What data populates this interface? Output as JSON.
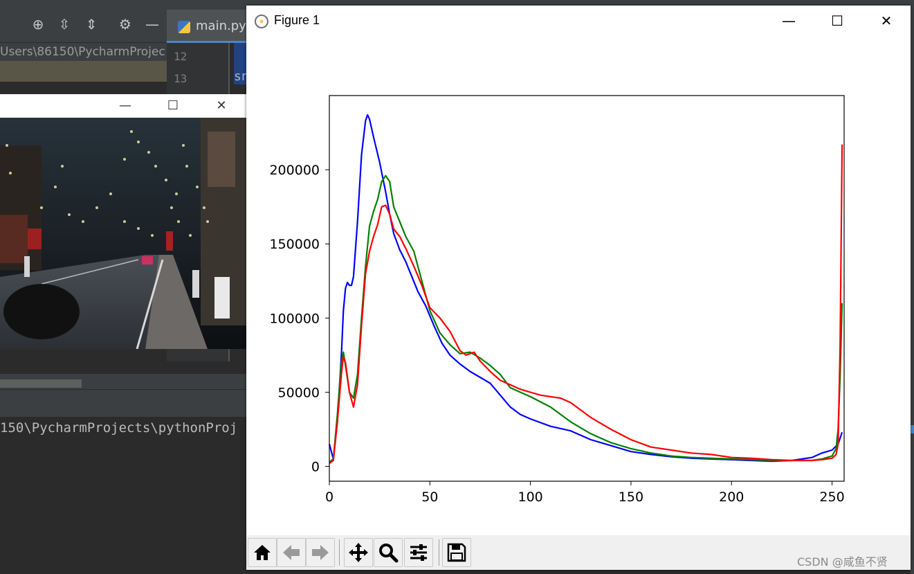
{
  "ide": {
    "tab_label": "main.py",
    "path_text": "Users\\86150\\PycharmProjec",
    "line_numbers": [
      "12",
      "13"
    ],
    "code_fragment": "sn",
    "console_text": "150\\PycharmProjects\\pythonProj",
    "top_right_label": "main"
  },
  "image_window": {
    "minimize_glyph": "—",
    "maximize_glyph": "☐",
    "close_glyph": "✕",
    "image_description": "night street with lit trees"
  },
  "figure": {
    "title": "Figure 1",
    "minimize_glyph": "—",
    "maximize_glyph": "☐",
    "close_glyph": "✕"
  },
  "toolbar_buttons": [
    "home",
    "back",
    "forward",
    "pan",
    "zoom",
    "configure-subplots",
    "save"
  ],
  "watermark": "CSDN @咸鱼不贤",
  "chart_data": {
    "type": "line",
    "title": "",
    "xlabel": "",
    "ylabel": "",
    "xlim": [
      0,
      256
    ],
    "ylim": [
      -10000,
      250000
    ],
    "xticks": [
      0,
      50,
      100,
      150,
      200,
      250
    ],
    "yticks": [
      0,
      50000,
      100000,
      150000,
      200000
    ],
    "legend": "none",
    "series": [
      {
        "color": "#0000ff",
        "x": [
          0,
          2,
          4,
          6,
          7,
          8,
          9,
          10,
          11,
          12,
          14,
          16,
          18,
          19,
          20,
          22,
          25,
          28,
          30,
          32,
          35,
          38,
          41,
          44,
          48,
          52,
          56,
          60,
          65,
          70,
          75,
          80,
          85,
          90,
          95,
          100,
          110,
          120,
          130,
          140,
          150,
          160,
          170,
          180,
          190,
          200,
          210,
          220,
          230,
          240,
          245,
          250,
          253,
          255
        ],
        "values": [
          15000,
          5000,
          30000,
          75000,
          105000,
          120000,
          124000,
          122000,
          122000,
          128000,
          165000,
          210000,
          233000,
          237000,
          234000,
          222000,
          205000,
          185000,
          170000,
          157000,
          146000,
          138000,
          128000,
          118000,
          108000,
          95000,
          83000,
          75000,
          69000,
          64000,
          60000,
          56000,
          48000,
          40000,
          35000,
          32000,
          27000,
          24000,
          18000,
          14000,
          10000,
          8000,
          6500,
          5500,
          5000,
          4500,
          4000,
          3500,
          4000,
          6000,
          9000,
          11000,
          15000,
          23000
        ]
      },
      {
        "color": "#008000",
        "x": [
          0,
          2,
          4,
          6,
          7,
          8,
          10,
          12,
          14,
          16,
          18,
          20,
          22,
          24,
          26,
          28,
          30,
          32,
          35,
          38,
          42,
          46,
          50,
          55,
          60,
          65,
          70,
          75,
          80,
          85,
          90,
          95,
          100,
          110,
          120,
          130,
          140,
          150,
          160,
          170,
          180,
          190,
          200,
          210,
          220,
          230,
          240,
          245,
          250,
          252,
          253,
          254,
          255
        ],
        "values": [
          3000,
          5000,
          35000,
          70000,
          77000,
          68000,
          50000,
          46000,
          62000,
          100000,
          135000,
          162000,
          172000,
          180000,
          192000,
          196000,
          192000,
          175000,
          165000,
          155000,
          145000,
          125000,
          105000,
          90000,
          82000,
          76000,
          77000,
          73000,
          68000,
          62000,
          53000,
          50000,
          47000,
          40000,
          30000,
          22000,
          16000,
          12000,
          9000,
          7000,
          6000,
          5500,
          5000,
          4500,
          4000,
          4000,
          4000,
          5000,
          7000,
          12000,
          25000,
          60000,
          110000
        ]
      },
      {
        "color": "#ff0000",
        "x": [
          0,
          2,
          4,
          6,
          7,
          8,
          10,
          12,
          14,
          16,
          18,
          20,
          22,
          24,
          26,
          28,
          30,
          32,
          35,
          38,
          42,
          46,
          50,
          55,
          60,
          65,
          68,
          70,
          72,
          75,
          80,
          85,
          90,
          95,
          100,
          105,
          110,
          115,
          120,
          130,
          140,
          150,
          160,
          170,
          180,
          190,
          200,
          210,
          220,
          230,
          240,
          245,
          250,
          252,
          253,
          254,
          255
        ],
        "values": [
          2000,
          4000,
          30000,
          62000,
          74000,
          70000,
          50000,
          40000,
          55000,
          95000,
          130000,
          145000,
          155000,
          163000,
          175000,
          176000,
          170000,
          160000,
          155000,
          147000,
          135000,
          122000,
          107000,
          100000,
          91000,
          78000,
          75000,
          76000,
          77000,
          71000,
          64000,
          58000,
          55000,
          52000,
          50000,
          48000,
          47000,
          46000,
          43000,
          33000,
          25000,
          18000,
          13000,
          11000,
          9000,
          8000,
          6000,
          5500,
          4500,
          4000,
          4000,
          4500,
          5500,
          8000,
          15000,
          80000,
          217000
        ]
      }
    ]
  }
}
